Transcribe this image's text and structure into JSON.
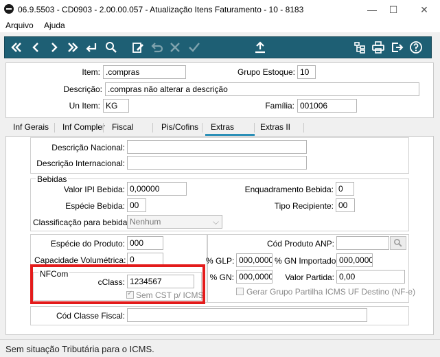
{
  "window": {
    "title": "06.9.5503 - CD0903 - 2.00.00.057 - Atualização Itens Faturamento - 10 - 8183",
    "minimize": "—",
    "maximize": "☐",
    "close": "✕"
  },
  "menu": {
    "items": [
      "Arquivo",
      "Ajuda"
    ]
  },
  "header": {
    "item_label": "Item:",
    "item_value": ".compras",
    "grupo_estoque_label": "Grupo Estoque:",
    "grupo_estoque_value": "10",
    "descricao_label": "Descrição:",
    "descricao_value": ".compras não alterar a descrição",
    "un_item_label": "Un Item:",
    "un_item_value": "KG",
    "familia_label": "Família:",
    "familia_value": "001006"
  },
  "tabs": [
    "Inf Gerais",
    "Inf Compler",
    "Fiscal",
    "Pis/Cofins",
    "Extras",
    "Extras II"
  ],
  "active_tab": "Extras",
  "descricoes": {
    "nacional_label": "Descrição Nacional:",
    "nacional_value": "",
    "internacional_label": "Descrição Internacional:",
    "internacional_value": ""
  },
  "bebidas": {
    "title": "Bebidas",
    "valor_ipi_label": "Valor IPI Bebida:",
    "valor_ipi_value": "0,00000",
    "enquadramento_label": "Enquadramento Bebida:",
    "enquadramento_value": "0",
    "especie_label": "Espécie Bebida:",
    "especie_value": "00",
    "tipo_recipiente_label": "Tipo Recipiente:",
    "tipo_recipiente_value": "00",
    "classificacao_label": "Classificação para bebidas:",
    "classificacao_value": "Nenhum"
  },
  "produto": {
    "especie_label": "Espécie do Produto:",
    "especie_value": "000",
    "capacidade_label": "Capacidade Volumétrica:",
    "capacidade_value": "0"
  },
  "nfcom": {
    "title": "NFCom",
    "cclass_label": "cClass:",
    "cclass_value": "1234567",
    "sem_cst_label": "Sem CST p/ ICMS"
  },
  "anp": {
    "cod_label": "Cód Produto ANP:",
    "cod_value": "",
    "glp_label": "% GLP:",
    "glp_value": "000,0000",
    "gn_importado_label": "% GN Importado:",
    "gn_importado_value": "000,0000",
    "gn_label": "% GN:",
    "gn_value": "000,0000",
    "valor_partida_label": "Valor Partida:",
    "valor_partida_value": "0,00",
    "gerar_grupo_label": "Gerar Grupo Partilha ICMS UF Destino (NF-e)"
  },
  "classe_fiscal": {
    "label": "Cód Classe Fiscal:",
    "value": ""
  },
  "status": {
    "text": "Sem situação Tributária para o ICMS."
  },
  "colors": {
    "toolbar": "#1e5f74",
    "highlight": "#e31b1b",
    "tab_accent": "#2a8fb7"
  }
}
